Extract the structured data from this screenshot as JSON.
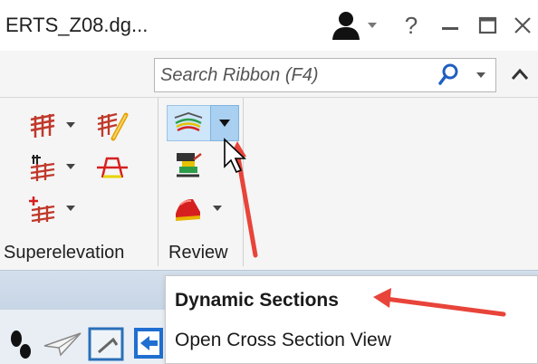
{
  "window": {
    "title": "ERTS_Z08.dg...",
    "help_label": "?",
    "minimize_glyph": "—",
    "maximize_glyph": "☐",
    "close_glyph": "✕"
  },
  "search": {
    "placeholder": "Search Ribbon (F4)"
  },
  "ribbon": {
    "groups": [
      {
        "label": "Superelevation"
      },
      {
        "label": "Review"
      }
    ]
  },
  "dropdown_menu": {
    "items": [
      {
        "label": "Dynamic Sections"
      },
      {
        "label": "Open Cross Section View"
      }
    ]
  },
  "colors": {
    "annotation_arrow": "#e8443a",
    "selected_button": "#cde6fa",
    "ribbon_bg": "#f5f5f5"
  }
}
